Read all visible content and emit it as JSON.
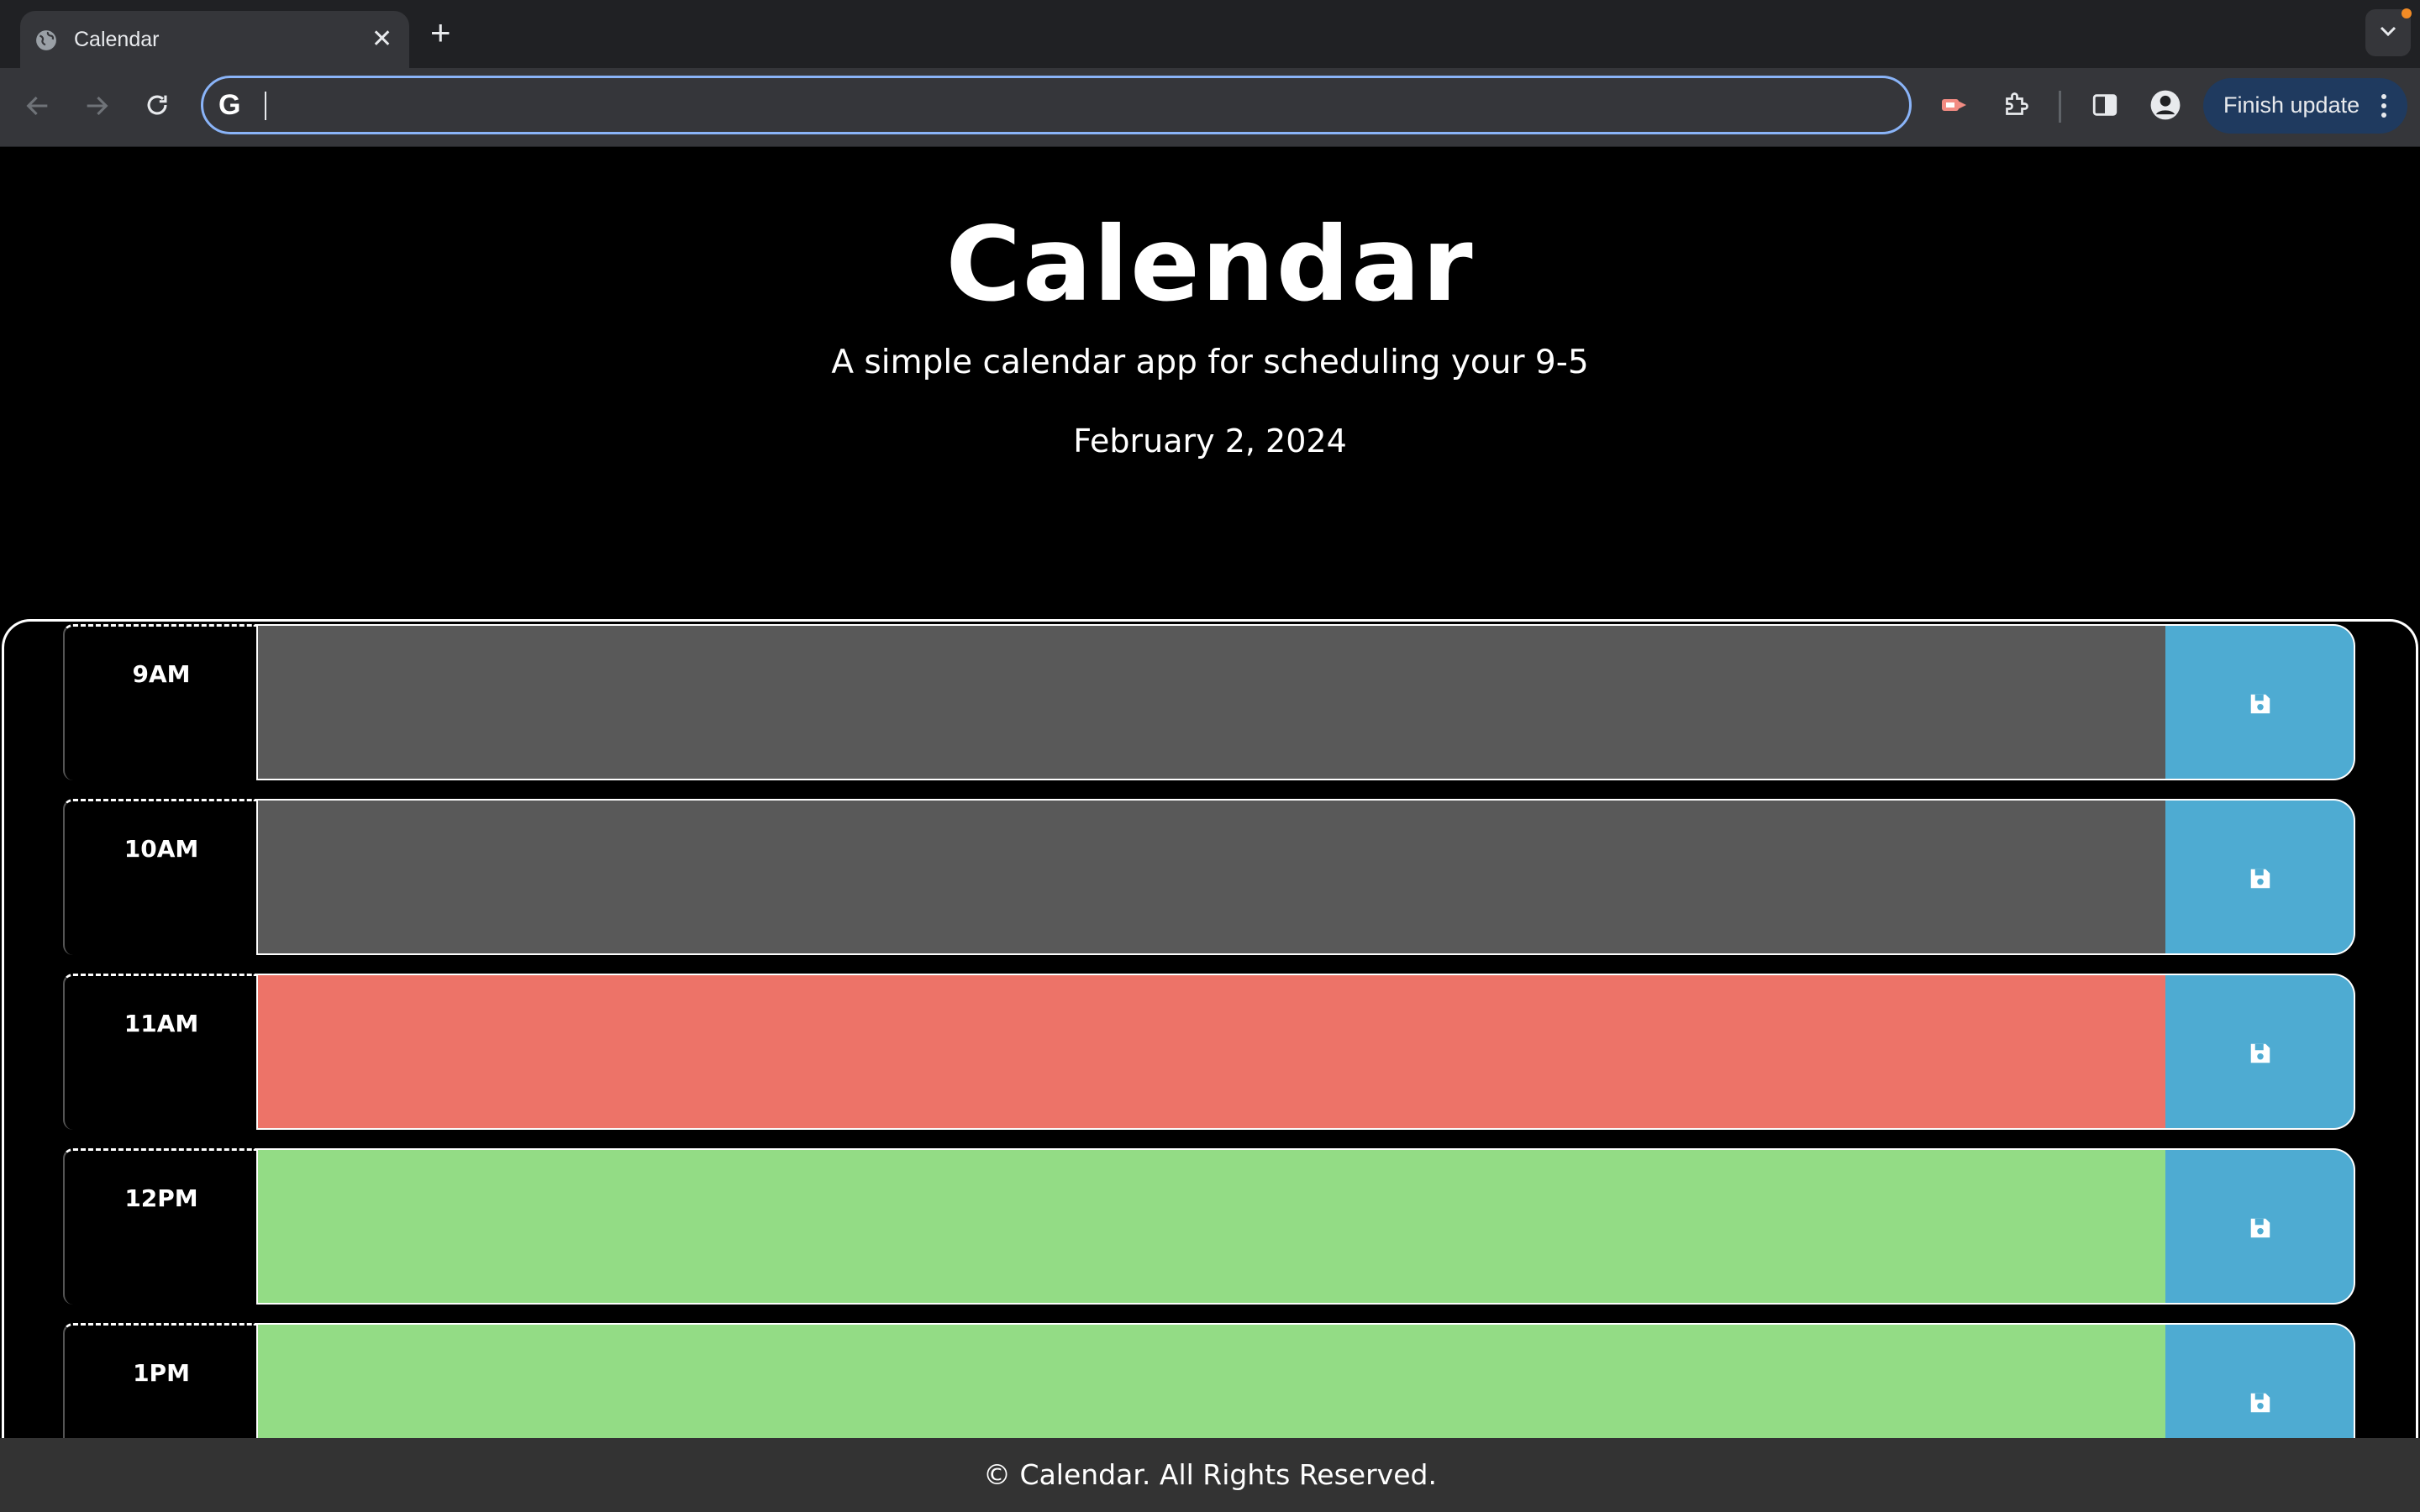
{
  "browser": {
    "tab_title": "Calendar",
    "tab_close": "✕",
    "new_tab": "+",
    "address_value": "",
    "finish_update": "Finish update"
  },
  "header": {
    "title": "Calendar",
    "subtitle": "A simple calendar app for scheduling your 9-5",
    "date": "February 2, 2024"
  },
  "colors": {
    "past": "#595959",
    "present": "#ed7368",
    "future": "#93dc85",
    "save": "#4eabd2"
  },
  "timeblocks": [
    {
      "hour": "9AM",
      "status": "past",
      "text": ""
    },
    {
      "hour": "10AM",
      "status": "past",
      "text": ""
    },
    {
      "hour": "11AM",
      "status": "present",
      "text": ""
    },
    {
      "hour": "12PM",
      "status": "future",
      "text": ""
    },
    {
      "hour": "1PM",
      "status": "future",
      "text": ""
    }
  ],
  "footer": {
    "text": "© Calendar. All Rights Reserved."
  }
}
